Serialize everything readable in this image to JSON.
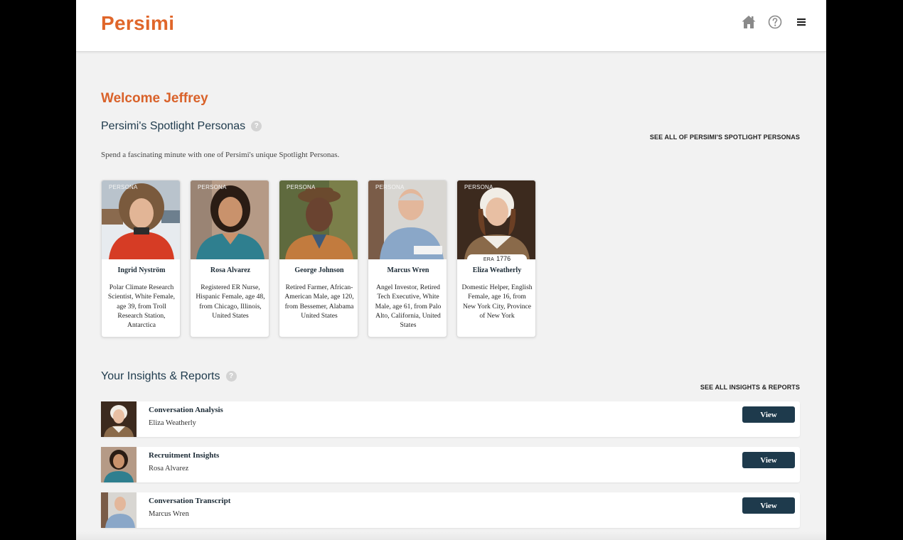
{
  "header": {
    "logo": "Persimi",
    "icons": [
      "home-icon",
      "help-icon",
      "menu-icon"
    ]
  },
  "welcome": "Welcome Jeffrey",
  "spotlight": {
    "title": "Persimi's Spotlight Personas",
    "see_all": "SEE ALL OF PERSIMI'S SPOTLIGHT PERSONAS",
    "intro": "Spend a fascinating minute with one of Persimi's unique Spotlight Personas.",
    "personas": [
      {
        "tag": "PERSONA",
        "name": "Ingrid Nyström",
        "description": "Polar Climate Research Scientist, White Female, age 39, from Troll Research Station, Antarctica"
      },
      {
        "tag": "PERSONA",
        "name": "Rosa Alvarez",
        "description": "Registered ER Nurse, Hispanic Female, age 48, from Chicago, Illinois, United States"
      },
      {
        "tag": "PERSONA",
        "name": "George Johnson",
        "description": "Retired Farmer, African-American Male, age 120, from Bessemer, Alabama United States"
      },
      {
        "tag": "PERSONA",
        "name": "Marcus Wren",
        "description": "Angel Investor, Retired Tech Executive, White Male, age 61, from Palo Alto, California, United States"
      },
      {
        "tag": "PERSONA",
        "name": "Eliza Weatherly",
        "era_label": "ERA",
        "era_year": "1776",
        "description": "Domestic Helper, English Female, age 16, from New York City, Province of New York"
      }
    ]
  },
  "insights": {
    "title": "Your Insights & Reports",
    "see_all": "SEE ALL INSIGHTS & REPORTS",
    "reports": [
      {
        "title": "Conversation Analysis",
        "persona": "Eliza Weatherly",
        "button": "View"
      },
      {
        "title": "Recruitment Insights",
        "persona": "Rosa Alvarez",
        "button": "View"
      },
      {
        "title": "Conversation Transcript",
        "persona": "Marcus Wren",
        "button": "View"
      }
    ]
  },
  "colors": {
    "brand_orange": "#e0662a",
    "navy": "#1e3a4c",
    "page_bg": "#f2f2f2"
  }
}
